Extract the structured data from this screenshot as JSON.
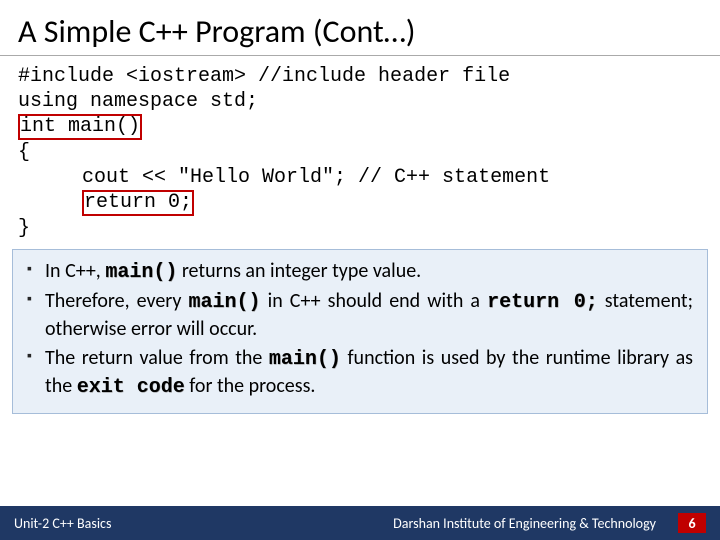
{
  "title": "A Simple C++ Program (Cont…)",
  "code": {
    "l1": "#include <iostream> //include header file",
    "l2": "using namespace std;",
    "l3": "int main()",
    "l4": "{",
    "l5": "cout << \"Hello World\"; // C++ statement",
    "l6": "return 0;",
    "l7": "}"
  },
  "notes": {
    "n1a": "In C++, ",
    "n1b": "main()",
    "n1c": " returns an integer type value.",
    "n2a": "Therefore, every ",
    "n2b": "main()",
    "n2c": " in C++ should end with a ",
    "n2d": "return 0;",
    "n2e": " statement; otherwise error will occur.",
    "n3a": "The return value from the ",
    "n3b": "main()",
    "n3c": " function is used by the runtime library as the ",
    "n3d": "exit code",
    "n3e": " for the process."
  },
  "footer": {
    "left": "Unit-2 C++ Basics",
    "right": "Darshan Institute of Engineering & Technology",
    "page": "6"
  }
}
